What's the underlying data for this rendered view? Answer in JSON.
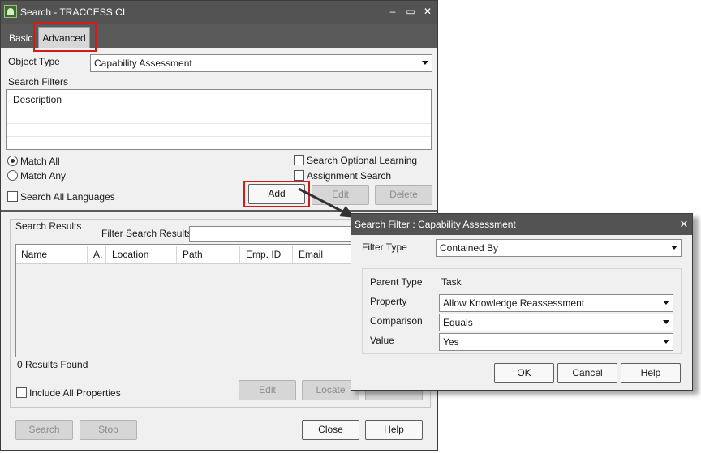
{
  "window": {
    "title": "Search - TRACCESS CI",
    "minimize_glyph": "–",
    "maximize_glyph": "▭",
    "close_glyph": "✕"
  },
  "tabs": {
    "basic": "Basic",
    "advanced": "Advanced",
    "active": "Advanced"
  },
  "object_type": {
    "label": "Object Type",
    "value": "Capability Assessment"
  },
  "search_filters": {
    "label": "Search Filters",
    "column_header": "Description",
    "rows": []
  },
  "options": {
    "match_all": "Match All",
    "match_any": "Match Any",
    "match_selected": "Match All",
    "search_all_languages": "Search All Languages",
    "search_optional_learning": "Search Optional Learning",
    "assignment_search": "Assignment Search"
  },
  "filter_buttons": {
    "add": "Add",
    "edit": "Edit",
    "delete": "Delete"
  },
  "results": {
    "group_label": "Search Results",
    "filter_label": "Filter Search Results",
    "filter_value": "",
    "columns": [
      "Name",
      "A.",
      "Location",
      "Path",
      "Emp. ID",
      "Email"
    ],
    "rows": [],
    "count_text": "0 Results Found",
    "include_all_properties": "Include All Properties",
    "buttons": {
      "edit": "Edit",
      "locate": "Locate"
    }
  },
  "footer_buttons": {
    "search": "Search",
    "stop": "Stop",
    "close": "Close",
    "help": "Help"
  },
  "dialog": {
    "title": "Search Filter : Capability Assessment",
    "close_glyph": "✕",
    "filter_type_label": "Filter Type",
    "filter_type_value": "Contained By",
    "parent_type_label": "Parent Type",
    "parent_type_value": "Task",
    "property_label": "Property",
    "property_value": "Allow Knowledge Reassessment",
    "comparison_label": "Comparison",
    "comparison_value": "Equals",
    "value_label": "Value",
    "value_value": "Yes",
    "buttons": {
      "ok": "OK",
      "cancel": "Cancel",
      "help": "Help"
    }
  },
  "colors": {
    "titlebar": "#535353",
    "highlight": "#d21c1c",
    "window_bg": "#f0f0f0"
  }
}
